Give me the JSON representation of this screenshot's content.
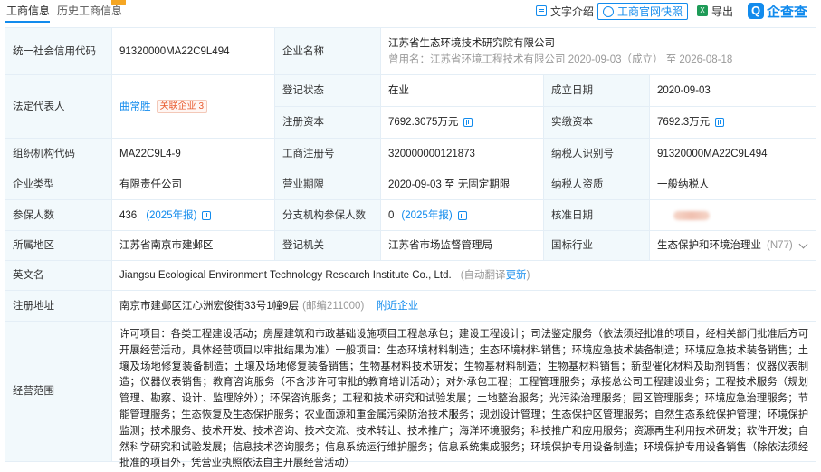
{
  "tabs": [
    {
      "label": "工商信息"
    },
    {
      "label": "历史工商信息"
    }
  ],
  "toolbar": {
    "text_intro": "文字介绍",
    "official_snapshot": "工商官网快照",
    "export": "导出",
    "logo_text": "企查查",
    "logo_mark": "Q"
  },
  "rows": {
    "credit_code": {
      "label": "统一社会信用代码",
      "value": "91320000MA22C9L494"
    },
    "company_name": {
      "label": "企业名称",
      "value": "江苏省生态环境技术研究院有限公司",
      "former": "曾用名：江苏省环境工程技术有限公司 2020-09-03（成立） 至 2026-08-18"
    },
    "legal_rep": {
      "label": "法定代表人",
      "value": "曲常胜",
      "tag_label": "关联企业",
      "tag_count": "3"
    },
    "reg_status": {
      "label": "登记状态",
      "value": "在业"
    },
    "est_date": {
      "label": "成立日期",
      "value": "2020-09-03"
    },
    "reg_capital": {
      "label": "注册资本",
      "value": "7692.3075万元"
    },
    "paid_capital": {
      "label": "实缴资本",
      "value": "7692.3万元"
    },
    "org_code": {
      "label": "组织机构代码",
      "value": "MA22C9L4-9"
    },
    "biz_reg_no": {
      "label": "工商注册号",
      "value": "320000000121873"
    },
    "taxpayer_id": {
      "label": "纳税人识别号",
      "value": "91320000MA22C9L494"
    },
    "company_type": {
      "label": "企业类型",
      "value": "有限责任公司"
    },
    "biz_term": {
      "label": "营业期限",
      "value": "2020-09-03 至 无固定期限"
    },
    "taxpayer_qual": {
      "label": "纳税人资质",
      "value": "一般纳税人"
    },
    "insured": {
      "label": "参保人数",
      "value": "436",
      "link": "(2025年报)"
    },
    "branch_insured": {
      "label": "分支机构参保人数",
      "value": "0",
      "link": "(2025年报)"
    },
    "approval_date": {
      "label": "核准日期"
    },
    "region": {
      "label": "所属地区",
      "value": "江苏省南京市建邺区"
    },
    "reg_authority": {
      "label": "登记机关",
      "value": "江苏省市场监督管理局"
    },
    "industry": {
      "label": "国标行业",
      "value": "生态保护和环境治理业",
      "code": "(N77)"
    },
    "english_name": {
      "label": "英文名",
      "value": "Jiangsu Ecological Environment Technology Research Institute Co., Ltd.",
      "note": "(自动翻译",
      "update": "更新",
      "note_end": ")"
    },
    "reg_address": {
      "label": "注册地址",
      "value": "南京市建邺区江心洲宏俊街33号1幢9层",
      "postcode": "(邮编211000)",
      "nearby": "附近企业"
    },
    "biz_scope": {
      "label": "经营范围",
      "value": "许可项目：各类工程建设活动；房屋建筑和市政基础设施项目工程总承包；建设工程设计；司法鉴定服务（依法须经批准的项目，经相关部门批准后方可开展经营活动，具体经营项目以审批结果为准）一般项目：生态环境材料制造；生态环境材料销售；环境应急技术装备制造；环境应急技术装备销售；土壤及场地修复装备制造；土壤及场地修复装备销售；生物基材料技术研发；生物基材料制造；生物基材料销售；新型催化材料及助剂销售；仪器仪表制造；仪器仪表销售；教育咨询服务（不含涉许可审批的教育培训活动）；对外承包工程；工程管理服务；承接总公司工程建设业务；工程技术服务（规划管理、勘察、设计、监理除外）；环保咨询服务；工程和技术研究和试验发展；土地整治服务；光污染治理服务；园区管理服务；环境应急治理服务；节能管理服务；生态恢复及生态保护服务；农业面源和重金属污染防治技术服务；规划设计管理；生态保护区管理服务；自然生态系统保护管理；环境保护监测；技术服务、技术开发、技术咨询、技术交流、技术转让、技术推广；海洋环境服务；科技推广和应用服务；资源再生利用技术研发；软件开发；自然科学研究和试验发展；信息技术咨询服务；信息系统运行维护服务；信息系统集成服务；环境保护专用设备制造；环境保护专用设备销售（除依法须经批准的项目外，凭营业执照依法自主开展经营活动）"
    }
  }
}
